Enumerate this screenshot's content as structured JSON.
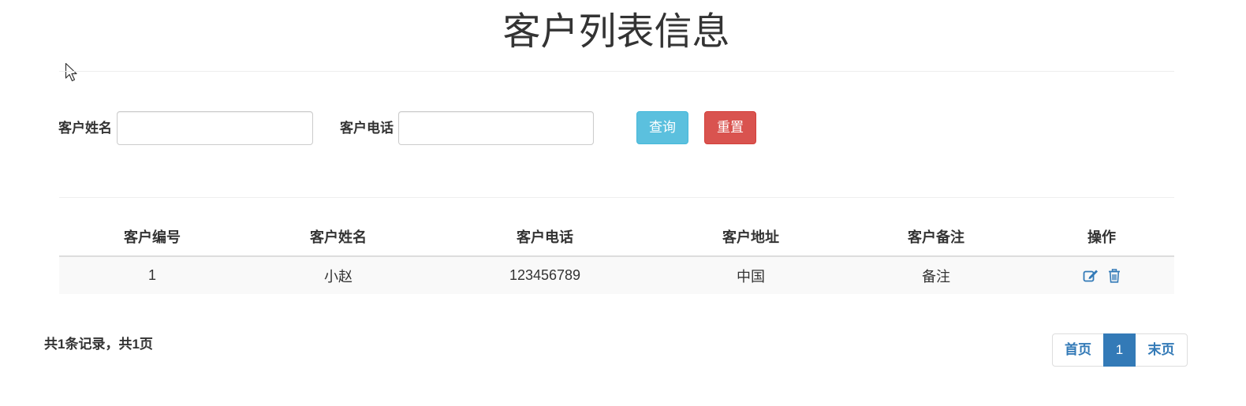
{
  "page_title": "客户列表信息",
  "search": {
    "name_label": "客户姓名",
    "name_value": "",
    "name_placeholder": "",
    "phone_label": "客户电话",
    "phone_value": "",
    "phone_placeholder": "",
    "query_label": "查询",
    "reset_label": "重置"
  },
  "table": {
    "columns": [
      "客户编号",
      "客户姓名",
      "客户电话",
      "客户地址",
      "客户备注",
      "操作"
    ],
    "rows": [
      {
        "id": "1",
        "name": "小赵",
        "phone": "123456789",
        "address": "中国",
        "remark": "备注",
        "actions": [
          "edit-icon",
          "delete-icon"
        ]
      }
    ]
  },
  "summary": "共1条记录，共1页",
  "pagination": {
    "first_label": "首页",
    "current_page": "1",
    "last_label": "末页"
  },
  "colors": {
    "info": "#5bc0de",
    "danger": "#d9534f",
    "primary": "#337ab7"
  }
}
